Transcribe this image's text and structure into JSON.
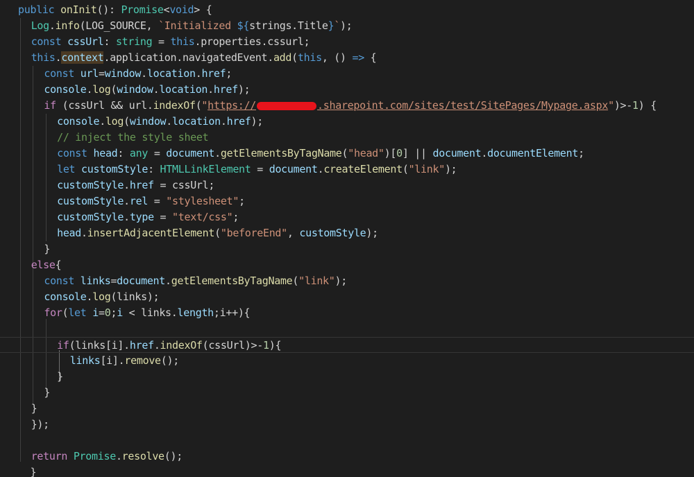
{
  "lines": [
    {
      "indent": 0,
      "tokens": [
        [
          "kw",
          "public "
        ],
        [
          "fn",
          "onInit"
        ],
        [
          "plain",
          "(): "
        ],
        [
          "type",
          "Promise"
        ],
        [
          "plain",
          "<"
        ],
        [
          "kw",
          "void"
        ],
        [
          "plain",
          "> {"
        ]
      ]
    },
    {
      "indent": 1,
      "tokens": [
        [
          "type",
          "Log"
        ],
        [
          "plain",
          "."
        ],
        [
          "fn",
          "info"
        ],
        [
          "plain",
          "(LOG_SOURCE, "
        ],
        [
          "str",
          "`Initialized "
        ],
        [
          "kw",
          "${"
        ],
        [
          "plain",
          "strings.Title"
        ],
        [
          "kw",
          "}"
        ],
        [
          "str",
          "`"
        ],
        [
          "plain",
          ");"
        ]
      ]
    },
    {
      "indent": 1,
      "tokens": [
        [
          "kw",
          "const "
        ],
        [
          "var",
          "cssUrl"
        ],
        [
          "plain",
          ": "
        ],
        [
          "type",
          "string"
        ],
        [
          "plain",
          " = "
        ],
        [
          "kw",
          "this"
        ],
        [
          "plain",
          ".properties.cssurl;"
        ]
      ]
    },
    {
      "indent": 1,
      "tokens": [
        [
          "kw",
          "this"
        ],
        [
          "plain",
          "."
        ],
        [
          "ctx",
          "context"
        ],
        [
          "plain",
          ".application.navigatedEvent."
        ],
        [
          "fn",
          "add"
        ],
        [
          "plain",
          "("
        ],
        [
          "kw",
          "this"
        ],
        [
          "plain",
          ", () "
        ],
        [
          "kw",
          "=>"
        ],
        [
          "plain",
          " {"
        ]
      ]
    },
    {
      "indent": 2,
      "tokens": [
        [
          "kw",
          "const "
        ],
        [
          "var",
          "url"
        ],
        [
          "plain",
          "="
        ],
        [
          "var",
          "window"
        ],
        [
          "plain",
          "."
        ],
        [
          "var",
          "location"
        ],
        [
          "plain",
          "."
        ],
        [
          "var",
          "href"
        ],
        [
          "plain",
          ";"
        ]
      ]
    },
    {
      "indent": 2,
      "tokens": [
        [
          "var",
          "console"
        ],
        [
          "plain",
          "."
        ],
        [
          "fn",
          "log"
        ],
        [
          "plain",
          "("
        ],
        [
          "var",
          "window"
        ],
        [
          "plain",
          "."
        ],
        [
          "var",
          "location"
        ],
        [
          "plain",
          "."
        ],
        [
          "var",
          "href"
        ],
        [
          "plain",
          ");"
        ]
      ]
    },
    {
      "indent": 2,
      "tokens": [
        [
          "ctl",
          "if "
        ],
        [
          "plain",
          "(cssUrl && url."
        ],
        [
          "fn",
          "indexOf"
        ],
        [
          "plain",
          "("
        ],
        [
          "str",
          "\""
        ],
        [
          "url",
          "https://"
        ],
        [
          "redact",
          ""
        ],
        [
          "url",
          ".sharepoint.com/sites/test/SitePages/Mypage.aspx"
        ],
        [
          "str",
          "\""
        ],
        [
          "plain",
          ")>-"
        ],
        [
          "num",
          "1"
        ],
        [
          "plain",
          ") {"
        ]
      ]
    },
    {
      "indent": 3,
      "tokens": [
        [
          "var",
          "console"
        ],
        [
          "plain",
          "."
        ],
        [
          "fn",
          "log"
        ],
        [
          "plain",
          "("
        ],
        [
          "var",
          "window"
        ],
        [
          "plain",
          "."
        ],
        [
          "var",
          "location"
        ],
        [
          "plain",
          "."
        ],
        [
          "var",
          "href"
        ],
        [
          "plain",
          ");"
        ]
      ]
    },
    {
      "indent": 3,
      "tokens": [
        [
          "cmt",
          "// inject the style sheet"
        ]
      ]
    },
    {
      "indent": 3,
      "tokens": [
        [
          "kw",
          "const "
        ],
        [
          "var",
          "head"
        ],
        [
          "plain",
          ": "
        ],
        [
          "type",
          "any"
        ],
        [
          "plain",
          " = "
        ],
        [
          "var",
          "document"
        ],
        [
          "plain",
          "."
        ],
        [
          "fn",
          "getElementsByTagName"
        ],
        [
          "plain",
          "("
        ],
        [
          "str",
          "\"head\""
        ],
        [
          "plain",
          ")["
        ],
        [
          "num",
          "0"
        ],
        [
          "plain",
          "] || "
        ],
        [
          "var",
          "document"
        ],
        [
          "plain",
          "."
        ],
        [
          "var",
          "documentElement"
        ],
        [
          "plain",
          ";"
        ]
      ]
    },
    {
      "indent": 3,
      "tokens": [
        [
          "kw",
          "let "
        ],
        [
          "var",
          "customStyle"
        ],
        [
          "plain",
          ": "
        ],
        [
          "type",
          "HTMLLinkElement"
        ],
        [
          "plain",
          " = "
        ],
        [
          "var",
          "document"
        ],
        [
          "plain",
          "."
        ],
        [
          "fn",
          "createElement"
        ],
        [
          "plain",
          "("
        ],
        [
          "str",
          "\"link\""
        ],
        [
          "plain",
          ");"
        ]
      ]
    },
    {
      "indent": 3,
      "tokens": [
        [
          "var",
          "customStyle"
        ],
        [
          "plain",
          "."
        ],
        [
          "var",
          "href"
        ],
        [
          "plain",
          " = cssUrl;"
        ]
      ]
    },
    {
      "indent": 3,
      "tokens": [
        [
          "var",
          "customStyle"
        ],
        [
          "plain",
          "."
        ],
        [
          "var",
          "rel"
        ],
        [
          "plain",
          " = "
        ],
        [
          "str",
          "\"stylesheet\""
        ],
        [
          "plain",
          ";"
        ]
      ]
    },
    {
      "indent": 3,
      "tokens": [
        [
          "var",
          "customStyle"
        ],
        [
          "plain",
          "."
        ],
        [
          "var",
          "type"
        ],
        [
          "plain",
          " = "
        ],
        [
          "str",
          "\"text/css\""
        ],
        [
          "plain",
          ";"
        ]
      ]
    },
    {
      "indent": 3,
      "tokens": [
        [
          "var",
          "head"
        ],
        [
          "plain",
          "."
        ],
        [
          "fn",
          "insertAdjacentElement"
        ],
        [
          "plain",
          "("
        ],
        [
          "str",
          "\"beforeEnd\""
        ],
        [
          "plain",
          ", "
        ],
        [
          "var",
          "customStyle"
        ],
        [
          "plain",
          ");"
        ]
      ]
    },
    {
      "indent": 2,
      "tokens": [
        [
          "plain",
          "}"
        ]
      ]
    },
    {
      "indent": 1,
      "tokens": [
        [
          "ctl",
          "else"
        ],
        [
          "plain",
          "{"
        ]
      ]
    },
    {
      "indent": 2,
      "tokens": [
        [
          "kw",
          "const "
        ],
        [
          "var",
          "links"
        ],
        [
          "plain",
          "="
        ],
        [
          "var",
          "document"
        ],
        [
          "plain",
          "."
        ],
        [
          "fn",
          "getElementsByTagName"
        ],
        [
          "plain",
          "("
        ],
        [
          "str",
          "\"link\""
        ],
        [
          "plain",
          ");"
        ]
      ]
    },
    {
      "indent": 2,
      "tokens": [
        [
          "var",
          "console"
        ],
        [
          "plain",
          "."
        ],
        [
          "fn",
          "log"
        ],
        [
          "plain",
          "(links);"
        ]
      ]
    },
    {
      "indent": 2,
      "tokens": [
        [
          "ctl",
          "for"
        ],
        [
          "plain",
          "("
        ],
        [
          "kw",
          "let "
        ],
        [
          "var",
          "i"
        ],
        [
          "plain",
          "="
        ],
        [
          "num",
          "0"
        ],
        [
          "plain",
          ";"
        ],
        [
          "var",
          "i"
        ],
        [
          "plain",
          " < links."
        ],
        [
          "var",
          "length"
        ],
        [
          "plain",
          ";i++){"
        ]
      ]
    },
    {
      "indent": 0,
      "tokens": []
    },
    {
      "indent": 3,
      "current": true,
      "tokens": [
        [
          "ctl",
          "if"
        ],
        [
          "plain",
          "(links[i]."
        ],
        [
          "var",
          "href"
        ],
        [
          "plain",
          "."
        ],
        [
          "fn",
          "indexOf"
        ],
        [
          "plain",
          "(cssUrl)>-"
        ],
        [
          "num",
          "1"
        ],
        [
          "plain",
          ")"
        ],
        [
          "bm",
          "{"
        ]
      ]
    },
    {
      "indent": 4,
      "tokens": [
        [
          "var",
          "links"
        ],
        [
          "plain",
          "[i]."
        ],
        [
          "fn",
          "remove"
        ],
        [
          "plain",
          "();"
        ]
      ]
    },
    {
      "indent": 3,
      "tokens": [
        [
          "bm",
          "}"
        ]
      ]
    },
    {
      "indent": 2,
      "tokens": [
        [
          "plain",
          "}"
        ]
      ]
    },
    {
      "indent": 1,
      "tokens": [
        [
          "plain",
          "}"
        ]
      ]
    },
    {
      "indent": 1,
      "tokens": [
        [
          "plain",
          "});"
        ]
      ]
    },
    {
      "indent": 0,
      "tokens": []
    },
    {
      "indent": 1,
      "tokens": [
        [
          "ctl",
          "return "
        ],
        [
          "type",
          "Promise"
        ],
        [
          "plain",
          "."
        ],
        [
          "fn",
          "resolve"
        ],
        [
          "plain",
          "();"
        ]
      ]
    },
    {
      "indent": 0,
      "tokens": [
        [
          "plain",
          "  }"
        ]
      ]
    }
  ]
}
